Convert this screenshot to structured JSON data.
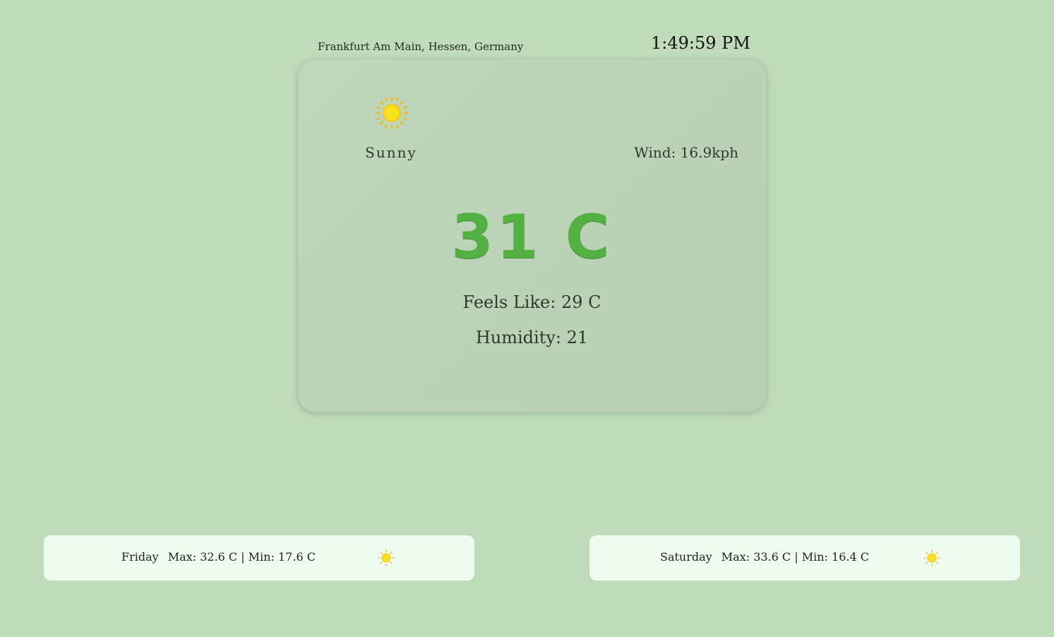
{
  "header": {
    "location": "Frankfurt Am Main, Hessen, Germany",
    "time": "1:49:59 PM"
  },
  "current": {
    "icon": "sun-icon",
    "condition": "Sunny",
    "wind": "Wind: 16.9kph",
    "temperature": "31 C",
    "feels_like": "Feels Like: 29 C",
    "humidity": "Humidity: 21"
  },
  "forecast": [
    {
      "day": "Friday",
      "range": "Max: 32.6 C | Min: 17.6 C",
      "icon": "sun-icon"
    },
    {
      "day": "Saturday",
      "range": "Max: 33.6 C | Min: 16.4 C",
      "icon": "sun-icon"
    }
  ],
  "colors": {
    "background": "#c0dbb9",
    "temperature": "#55b043",
    "forecast_card": "#eefbee",
    "sun": "#f5d11e"
  }
}
